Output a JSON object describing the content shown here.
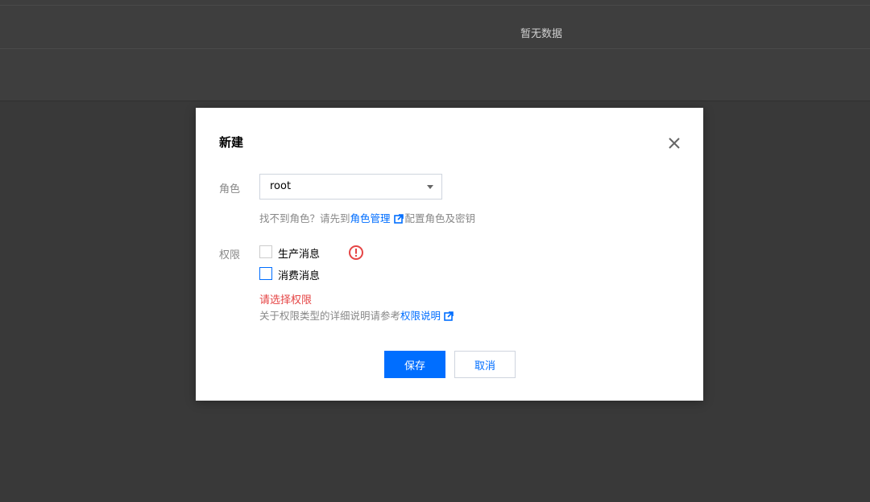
{
  "background": {
    "empty_text": "暂无数据"
  },
  "dialog": {
    "title": "新建",
    "role_label": "角色",
    "role_value": "root",
    "role_help_prefix": "找不到角色？请先到",
    "role_help_link": "角色管理",
    "role_help_suffix": "配置角色及密钥",
    "permission_label": "权限",
    "permissions": [
      {
        "label": "生产消息",
        "checked": false
      },
      {
        "label": "消费消息",
        "checked": false
      }
    ],
    "error_text": "请选择权限",
    "perm_help_prefix": "关于权限类型的详细说明请参考",
    "perm_help_link": "权限说明",
    "save_label": "保存",
    "cancel_label": "取消"
  },
  "colors": {
    "primary": "#006eff",
    "error": "#e54545"
  }
}
